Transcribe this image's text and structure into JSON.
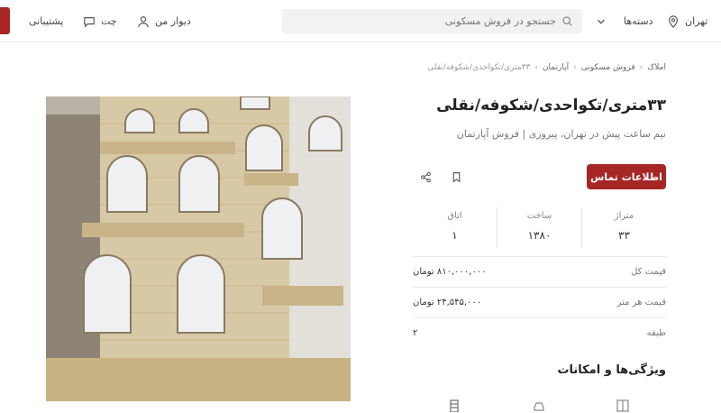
{
  "header": {
    "location": "تهران",
    "categories": "دسته‌ها",
    "search_placeholder": "جستجو در فروش مسکونی",
    "my_divar": "دیوار من",
    "chat": "چت",
    "support": "پشتیبانی"
  },
  "breadcrumb": [
    "املاک",
    "فروش مسکونی",
    "آپارتمان",
    "۳۳متری/تکواحدی/شکوفه/نقلی"
  ],
  "listing": {
    "title": "۳۳متری/تکواحدی/شکوفه/نقلی",
    "subtitle": "نیم ساعت پیش در تهران، پیروزی | فروش آپارتمان",
    "contact_label": "اطلاعات تماس"
  },
  "stats": [
    {
      "label": "متراژ",
      "value": "۳۳"
    },
    {
      "label": "ساخت",
      "value": "۱۳۸۰"
    },
    {
      "label": "اتاق",
      "value": "۱"
    }
  ],
  "details": [
    {
      "label": "قیمت کل",
      "value": "۸۱۰,۰۰۰,۰۰۰ تومان"
    },
    {
      "label": "قیمت هر متر",
      "value": "۲۴,۵۴۵,۰۰۰ تومان"
    },
    {
      "label": "طبقه",
      "value": "۲"
    }
  ],
  "features_title": "ویژگی‌ها و امکانات",
  "colors": {
    "accent": "#a62626"
  }
}
